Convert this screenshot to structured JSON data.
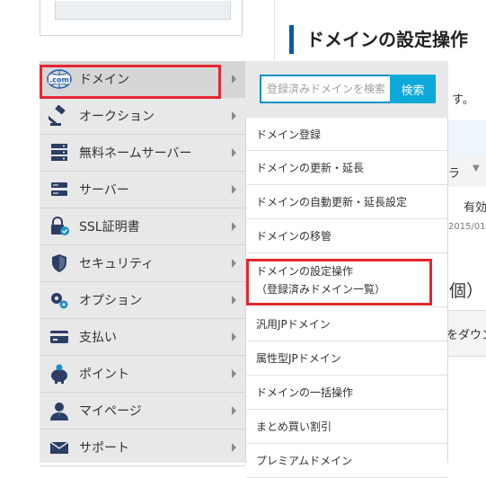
{
  "page": {
    "title": "ドメインの設定操作",
    "text_su": "す。",
    "col_ra": "ラ",
    "col_yuko": "有効",
    "date_partial": "2015/01,",
    "count_suffix": "個）",
    "download_partial": "をダウン"
  },
  "nav": {
    "items": [
      {
        "label": "ドメイン",
        "icon": "dotcom-globe-icon"
      },
      {
        "label": "オークション",
        "icon": "gavel-icon"
      },
      {
        "label": "無料ネームサーバー",
        "icon": "server-icon"
      },
      {
        "label": "サーバー",
        "icon": "server-stack-icon"
      },
      {
        "label": "SSL証明書",
        "icon": "ssl-lock-icon"
      },
      {
        "label": "セキュリティ",
        "icon": "shield-icon"
      },
      {
        "label": "オプション",
        "icon": "gears-icon"
      },
      {
        "label": "支払い",
        "icon": "credit-card-icon"
      },
      {
        "label": "ポイント",
        "icon": "piggy-bank-icon"
      },
      {
        "label": "マイページ",
        "icon": "user-icon"
      },
      {
        "label": "サポート",
        "icon": "mail-icon"
      }
    ]
  },
  "submenu": {
    "search_placeholder": "登録済みドメインを検索",
    "search_button": "検索",
    "items": [
      {
        "label": "ドメイン登録"
      },
      {
        "label": "ドメインの更新・延長"
      },
      {
        "label": "ドメインの自動更新・延長設定"
      },
      {
        "label": "ドメインの移管"
      },
      {
        "label": "ドメインの設定操作",
        "sub": "（登録済みドメイン一覧）"
      },
      {
        "label": "汎用JPドメイン"
      },
      {
        "label": "属性型JPドメイン"
      },
      {
        "label": "ドメインの一括操作"
      },
      {
        "label": "まとめ買い割引"
      },
      {
        "label": "プレミアムドメイン"
      }
    ]
  },
  "colors": {
    "accent_blue": "#0ba8d8",
    "highlight_red": "#e5262f",
    "title_bar": "#0b5aa8"
  }
}
